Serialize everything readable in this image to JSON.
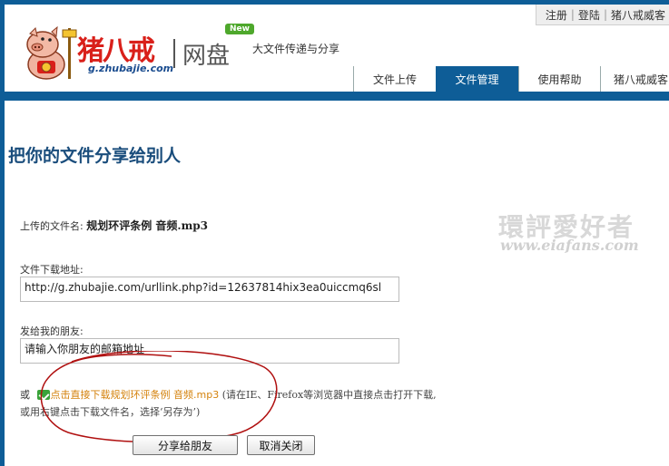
{
  "header": {
    "top_links": [
      "注册",
      "登陆",
      "猪八戒威客"
    ],
    "logo_text": "猪八戒",
    "logo_url": "g.zhubajie.com",
    "logo_product": "网盘",
    "new_badge": "New",
    "slogan": "大文件传递与分享",
    "nav_tabs": [
      {
        "label": "文件上传",
        "active": false
      },
      {
        "label": "文件管理",
        "active": true
      },
      {
        "label": "使用帮助",
        "active": false
      },
      {
        "label": "猪八戒威客",
        "active": false
      }
    ]
  },
  "main": {
    "page_title": "把你的文件分享给别人",
    "watermark_cn": "環評愛好者",
    "watermark_url": "www.eiafans.com",
    "file_label": "上传的文件名:",
    "file_name": "规划环评条例 音频.mp3",
    "url_label": "文件下载地址:",
    "url_value": "http://g.zhubajie.com/urllink.php?id=12637814hix3ea0uiccmq6sl",
    "friend_label": "发给我的朋友:",
    "friend_placeholder": "请输入你朋友的邮箱地址",
    "or_text": "或",
    "download_link": "点击直接下载规划环评条例 音频.mp3",
    "download_hint": "(请在IE、Firefox等浏览器中直接点击打开下载,或用右键点击下载文件名，选择‘另存为’)",
    "share_button": "分享给朋友",
    "cancel_button": "取消关闭"
  },
  "colors": {
    "brand_blue": "#0e5d97",
    "title_blue": "#1a4d7c",
    "link_orange": "#d4820c",
    "logo_red": "#d9201a",
    "annotation_red": "#b01010"
  }
}
